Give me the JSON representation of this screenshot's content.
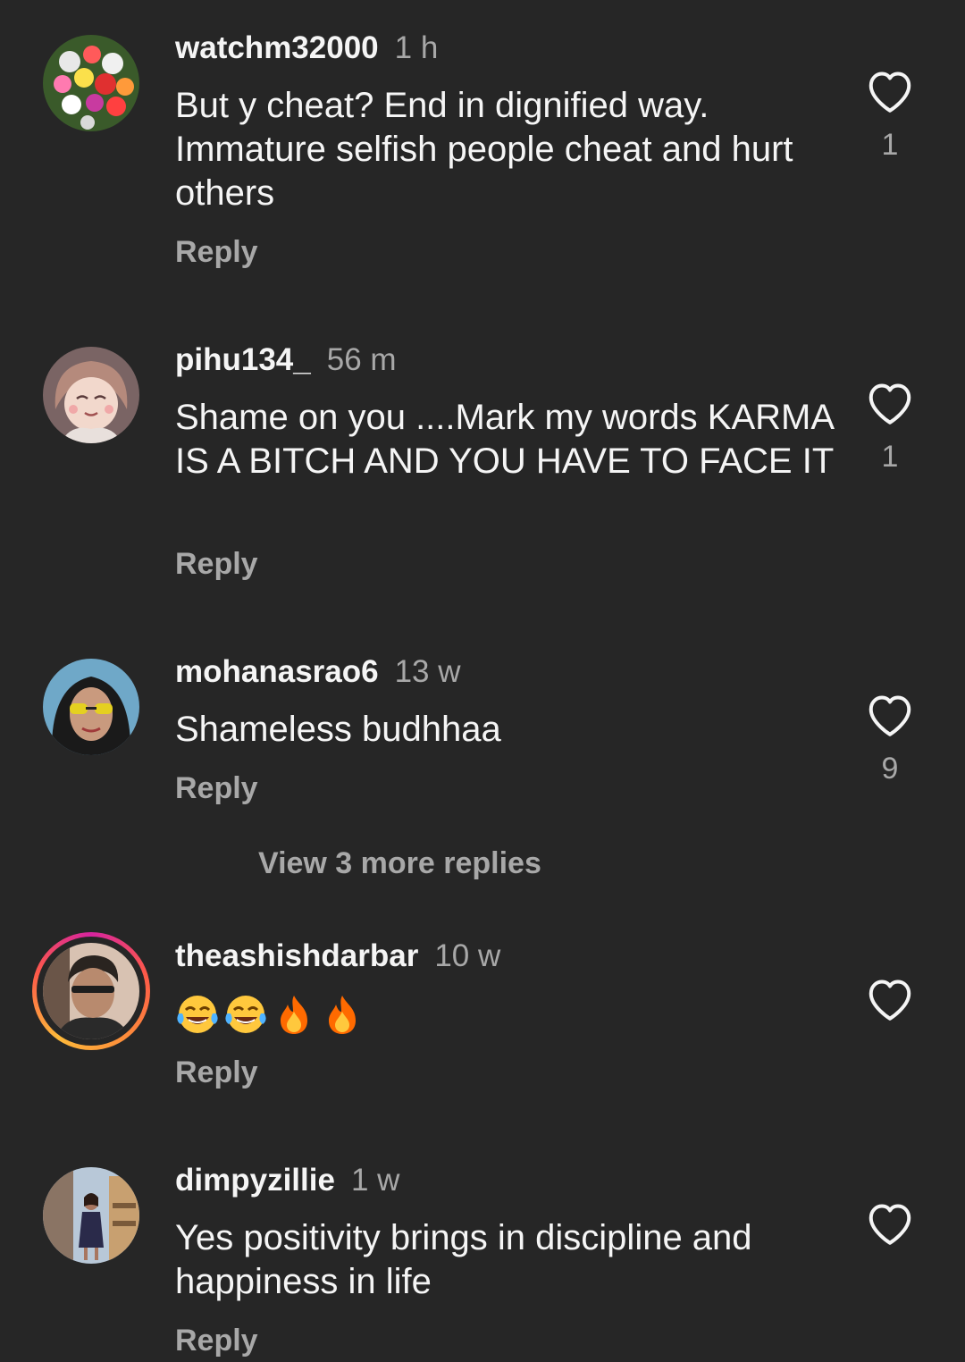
{
  "comments": [
    {
      "username": "watchm32000",
      "time": "1 h",
      "text": "But y cheat? End in dignified way. Immature selfish people cheat and hurt others",
      "likes": "1",
      "reply_label": "Reply",
      "avatar_icon": "flower-bouquet-avatar"
    },
    {
      "username": "pihu134_",
      "time": "56 m",
      "text": "Shame on you ....Mark my words KARMA IS A BITCH AND YOU HAVE TO FACE IT",
      "likes": "1",
      "reply_label": "Reply",
      "avatar_icon": "anime-girl-avatar"
    },
    {
      "username": "mohanasrao6",
      "time": "13 w",
      "text": "Shameless budhhaa",
      "likes": "9",
      "reply_label": "Reply",
      "avatar_icon": "woman-sunglasses-avatar"
    },
    {
      "username": "theashishdarbar",
      "time": "10 w",
      "text": "",
      "emojis": [
        "face-with-tears-of-joy",
        "face-with-tears-of-joy",
        "fire",
        "fire"
      ],
      "likes": "",
      "reply_label": "Reply",
      "avatar_icon": "man-glasses-avatar",
      "has_story_ring": true
    },
    {
      "username": "dimpyzillie",
      "time": "1 w",
      "text": "Yes positivity brings in discipline and happiness in life",
      "likes": "",
      "reply_label": "Reply",
      "avatar_icon": "woman-standing-avatar"
    }
  ],
  "view_more_replies": "View 3 more replies",
  "colors": {
    "background": "#262626",
    "primary_text": "#f5f5f5",
    "secondary_text": "#a8a8a8",
    "story_ring_start": "#d6249f",
    "story_ring_end": "#fdb93a"
  }
}
